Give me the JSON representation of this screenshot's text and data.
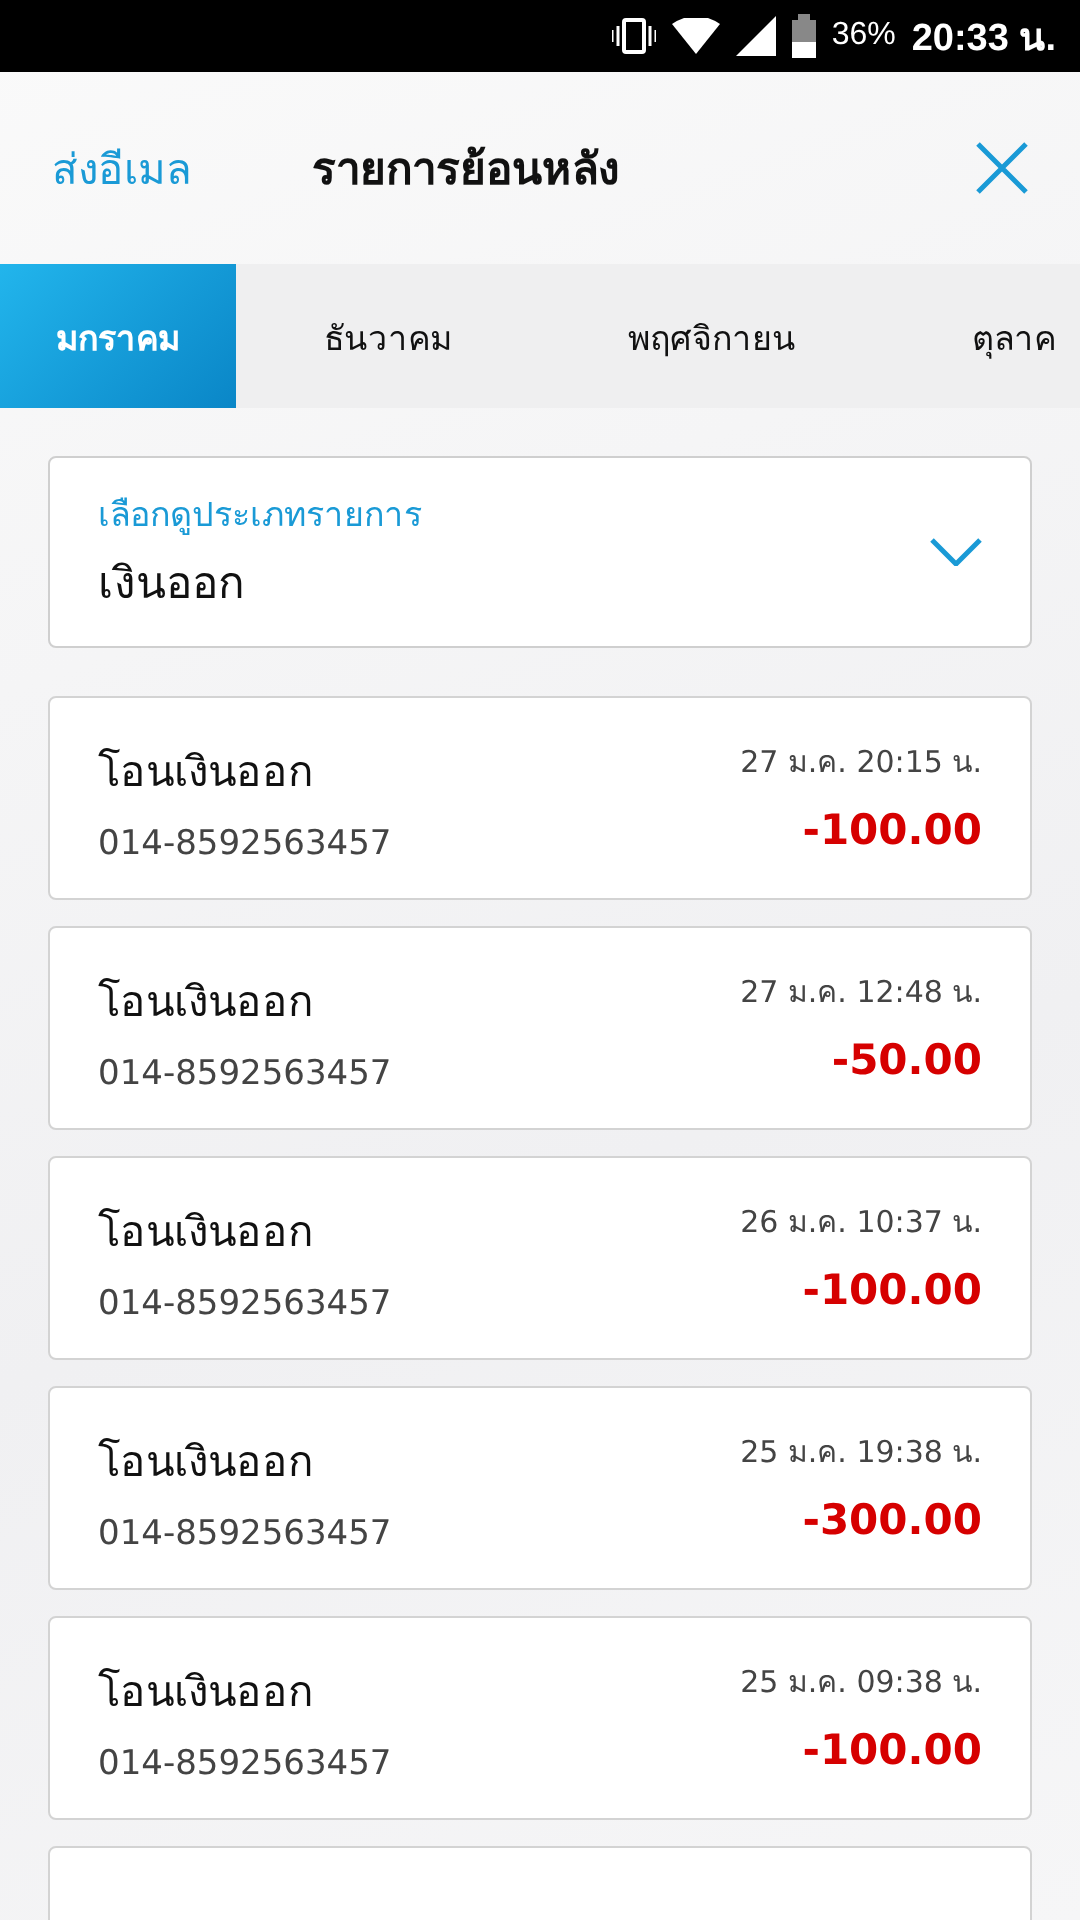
{
  "status_bar": {
    "battery": "36%",
    "time": "20:33 น."
  },
  "header": {
    "left_action": "ส่งอีเมล",
    "title": "รายการย้อนหลัง"
  },
  "tabs": [
    {
      "label": "มกราคม",
      "selected": true
    },
    {
      "label": "ธันวาคม",
      "selected": false
    },
    {
      "label": "พฤศจิกายน",
      "selected": false
    },
    {
      "label": "ตุลาค",
      "selected": false
    }
  ],
  "filter": {
    "label": "เลือกดูประเภทรายการ",
    "value": "เงินออก"
  },
  "transactions": [
    {
      "title": "โอนเงินออก",
      "account": "014-8592563457",
      "datetime": "27 ม.ค. 20:15 น.",
      "amount": "-100.00"
    },
    {
      "title": "โอนเงินออก",
      "account": "014-8592563457",
      "datetime": "27 ม.ค. 12:48 น.",
      "amount": "-50.00"
    },
    {
      "title": "โอนเงินออก",
      "account": "014-8592563457",
      "datetime": "26 ม.ค. 10:37 น.",
      "amount": "-100.00"
    },
    {
      "title": "โอนเงินออก",
      "account": "014-8592563457",
      "datetime": "25 ม.ค. 19:38 น.",
      "amount": "-300.00"
    },
    {
      "title": "โอนเงินออก",
      "account": "014-8592563457",
      "datetime": "25 ม.ค. 09:38 น.",
      "amount": "-100.00"
    }
  ],
  "more_below": true
}
